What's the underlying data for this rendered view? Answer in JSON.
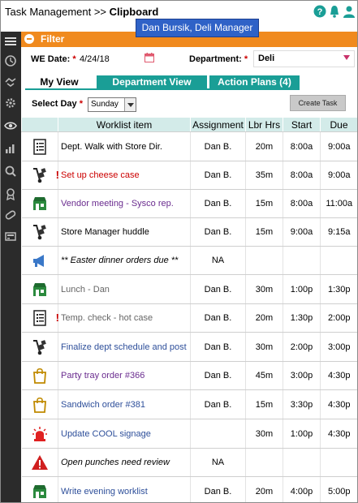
{
  "header": {
    "breadcrumb": "Task Management >> ",
    "page": "Clipboard",
    "user_badge": "Dan Bursik, Deli Manager",
    "icons": [
      "help-icon",
      "bell-icon",
      "user-icon"
    ]
  },
  "sidebar": {
    "icons": [
      "menu-icon",
      "clock-icon",
      "handshake-icon",
      "gear-icon",
      "eye-icon",
      "chart-icon",
      "magnifier-icon",
      "award-icon",
      "pill-icon",
      "register-icon"
    ]
  },
  "filter": {
    "label": "Filter",
    "we_date_label": "WE Date:",
    "we_date_value": "4/24/18",
    "required_mark": "*",
    "department_label": "Department:",
    "department_value": "Deli"
  },
  "tabs": [
    {
      "label": "My View",
      "active": true
    },
    {
      "label": "Department View",
      "active": false
    },
    {
      "label": "Action Plans (4)",
      "active": false
    }
  ],
  "day": {
    "label": "Select Day",
    "value": "Sunday"
  },
  "create_task_label": "Create Task",
  "table": {
    "columns": [
      "",
      "Worklist item",
      "Assignment",
      "Lbr Hrs",
      "Start",
      "Due"
    ],
    "rows": [
      {
        "icon": "checklist-icon",
        "flag": "",
        "item": "Dept. Walk with Store Dir.",
        "style": "black",
        "assignment": "Dan B.",
        "hrs": "20m",
        "start": "8:00a",
        "due": "9:00a"
      },
      {
        "icon": "hand-truck-icon",
        "flag": "!",
        "item": "Set up cheese case",
        "style": "red",
        "assignment": "Dan B.",
        "hrs": "35m",
        "start": "8:00a",
        "due": "9:00a"
      },
      {
        "icon": "storefront-icon",
        "flag": "",
        "item": "Vendor meeting - Sysco rep.",
        "style": "purple",
        "assignment": "Dan B.",
        "hrs": "15m",
        "start": "8:00a",
        "due": "11:00a"
      },
      {
        "icon": "hand-truck-icon",
        "flag": "",
        "item": "Store Manager huddle",
        "style": "black",
        "assignment": "Dan B.",
        "hrs": "15m",
        "start": "9:00a",
        "due": "9:15a"
      },
      {
        "icon": "megaphone-icon",
        "flag": "",
        "item": "** Easter dinner orders due **",
        "style": "italic",
        "assignment": "NA",
        "hrs": "",
        "start": "",
        "due": ""
      },
      {
        "icon": "storefront-icon",
        "flag": "",
        "item": "Lunch - Dan",
        "style": "gray",
        "assignment": "Dan B.",
        "hrs": "30m",
        "start": "1:00p",
        "due": "1:30p"
      },
      {
        "icon": "checklist-icon",
        "flag": "!",
        "item": "Temp. check - hot case",
        "style": "gray",
        "assignment": "Dan B.",
        "hrs": "20m",
        "start": "1:30p",
        "due": "2:00p"
      },
      {
        "icon": "hand-truck-icon",
        "flag": "",
        "item": "Finalize dept schedule and post",
        "style": "blue",
        "assignment": "Dan B.",
        "hrs": "30m",
        "start": "2:00p",
        "due": "3:00p"
      },
      {
        "icon": "shopping-bag-icon",
        "flag": "",
        "item": "Party tray order #366",
        "style": "purple",
        "assignment": "Dan B.",
        "hrs": "45m",
        "start": "3:00p",
        "due": "4:30p"
      },
      {
        "icon": "shopping-bag-icon",
        "flag": "",
        "item": "Sandwich order #381",
        "style": "blue",
        "assignment": "Dan B.",
        "hrs": "15m",
        "start": "3:30p",
        "due": "4:30p"
      },
      {
        "icon": "siren-icon",
        "flag": "",
        "item": "Update COOL signage",
        "style": "blue",
        "assignment": "",
        "hrs": "30m",
        "start": "1:00p",
        "due": "4:30p"
      },
      {
        "icon": "warning-icon",
        "flag": "",
        "item": "Open punches need review",
        "style": "italic",
        "assignment": "NA",
        "hrs": "",
        "start": "",
        "due": ""
      },
      {
        "icon": "storefront-icon",
        "flag": "",
        "item": "Write evening worklist",
        "style": "blue",
        "assignment": "Dan B.",
        "hrs": "20m",
        "start": "4:00p",
        "due": "5:00p"
      }
    ]
  },
  "colors": {
    "filter_bar": "#f08a1e",
    "tab": "#1a9e96",
    "header_row": "#d3ebe9",
    "sidebar": "#2b2b2b",
    "badge": "#2f62c7",
    "flag": "#cc0000"
  }
}
